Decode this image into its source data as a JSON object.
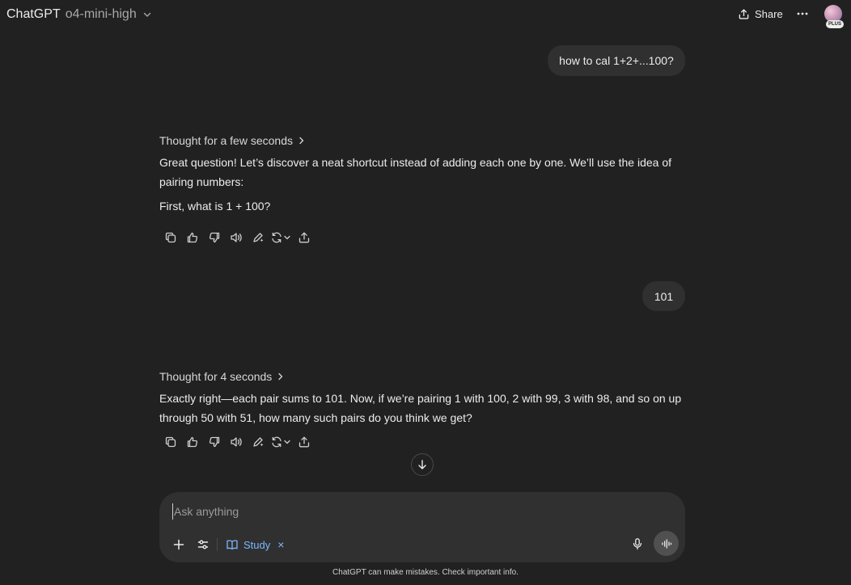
{
  "header": {
    "app_title": "ChatGPT",
    "model_name": "o4-mini-high",
    "share_label": "Share",
    "plan_badge": "PLUS"
  },
  "messages": {
    "user1": "how to cal 1+2+...100?",
    "assistant1": {
      "thought_label": "Thought for a few seconds",
      "para1": "Great question! Let’s discover a neat shortcut instead of adding each one by one. We’ll use the idea of pairing numbers:",
      "para2": "First, what is 1 + 100?"
    },
    "user2": "101",
    "assistant2": {
      "thought_label": "Thought for 4 seconds",
      "para1": "Exactly right—each pair sums to 101. Now, if we’re pairing 1 with 100, 2 with 99, 3 with 98, and so on up through 50 with 51, how many such pairs do you think we get?"
    }
  },
  "composer": {
    "placeholder": "Ask anything",
    "value": "",
    "study_label": "Study",
    "study_close": "×"
  },
  "footer": {
    "disclaimer": "ChatGPT can make mistakes. Check important info."
  },
  "icons": {
    "message_actions": [
      "copy-icon",
      "thumbs-up-icon",
      "thumbs-down-icon",
      "read-aloud-icon",
      "edit-icon",
      "regenerate-icon",
      "share-icon"
    ],
    "composer": [
      "plus-icon",
      "tools-icon",
      "study-book-icon",
      "mic-icon",
      "voice-waveform-icon"
    ]
  },
  "colors": {
    "background": "#212121",
    "bubble": "#303030",
    "accent": "#7cb7ff"
  }
}
